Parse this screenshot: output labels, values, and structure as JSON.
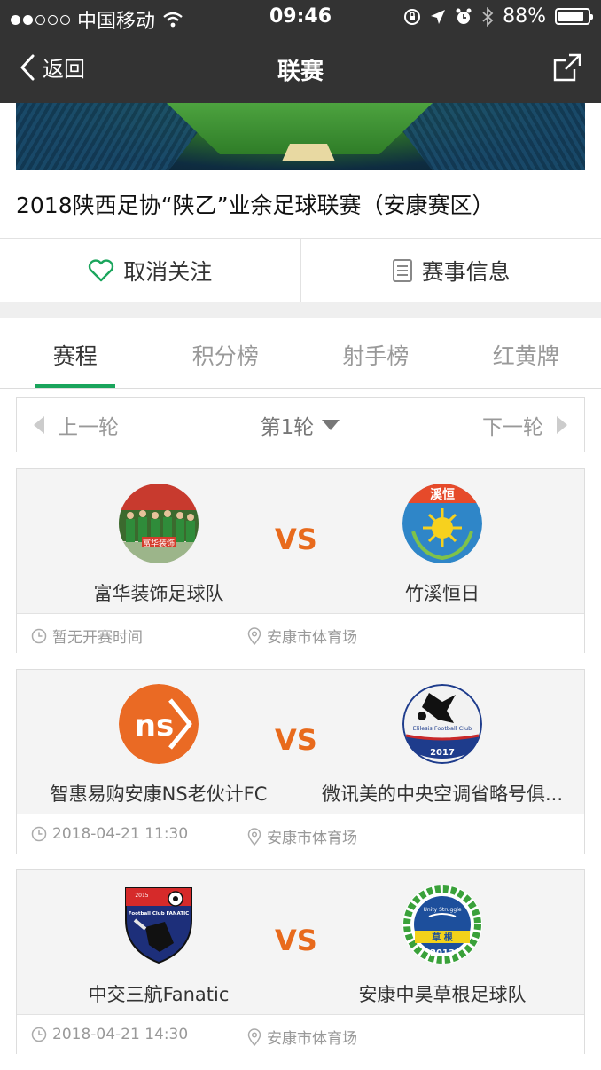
{
  "status_bar": {
    "carrier": "中国移动",
    "time": "09:46",
    "battery": "88%",
    "battery_level": 0.88
  },
  "nav": {
    "back_label": "返回",
    "title": "联赛"
  },
  "league": {
    "title": "2018陕西足协“陕乙”业余足球联赛（安康赛区）"
  },
  "actions": {
    "follow_label": "取消关注",
    "info_label": "赛事信息"
  },
  "tabs": [
    {
      "label": "赛程",
      "active": true
    },
    {
      "label": "积分榜",
      "active": false
    },
    {
      "label": "射手榜",
      "active": false
    },
    {
      "label": "红黄牌",
      "active": false
    }
  ],
  "round": {
    "prev_label": "上一轮",
    "current_label": "第1轮",
    "next_label": "下一轮"
  },
  "matches": [
    {
      "home": "富华装饰足球队",
      "away": "竹溪恒日",
      "vs": "VS",
      "time": "暂无开赛时间",
      "venue": "安康市体育场"
    },
    {
      "home": "智惠易购安康NS老伙计FC",
      "away": "微讯美的中央空调省略号俱...",
      "vs": "VS",
      "time": "2018-04-21 11:30",
      "venue": "安康市体育场"
    },
    {
      "home": "中交三航Fanatic",
      "away": "安康中昊草根足球队",
      "vs": "VS",
      "time": "2018-04-21 14:30",
      "venue": "安康市体育场"
    }
  ],
  "logos": {
    "team1_home_text": "富华装饰",
    "team1_away_text": "溪恒",
    "team2_home_text": "ns",
    "team2_away_text": "2017",
    "team2_away_arc": "Elilesis Football Club",
    "team3_home_text": "Football Club FANATIC",
    "team3_home_year": "2015",
    "team3_away_top": "Unity Struggle",
    "team3_away_mid": "草 根",
    "team3_away_year": "2013"
  },
  "colors": {
    "accent_green": "#1aa55c",
    "vs_orange": "#e86a1c",
    "nav_bg": "#333333"
  }
}
